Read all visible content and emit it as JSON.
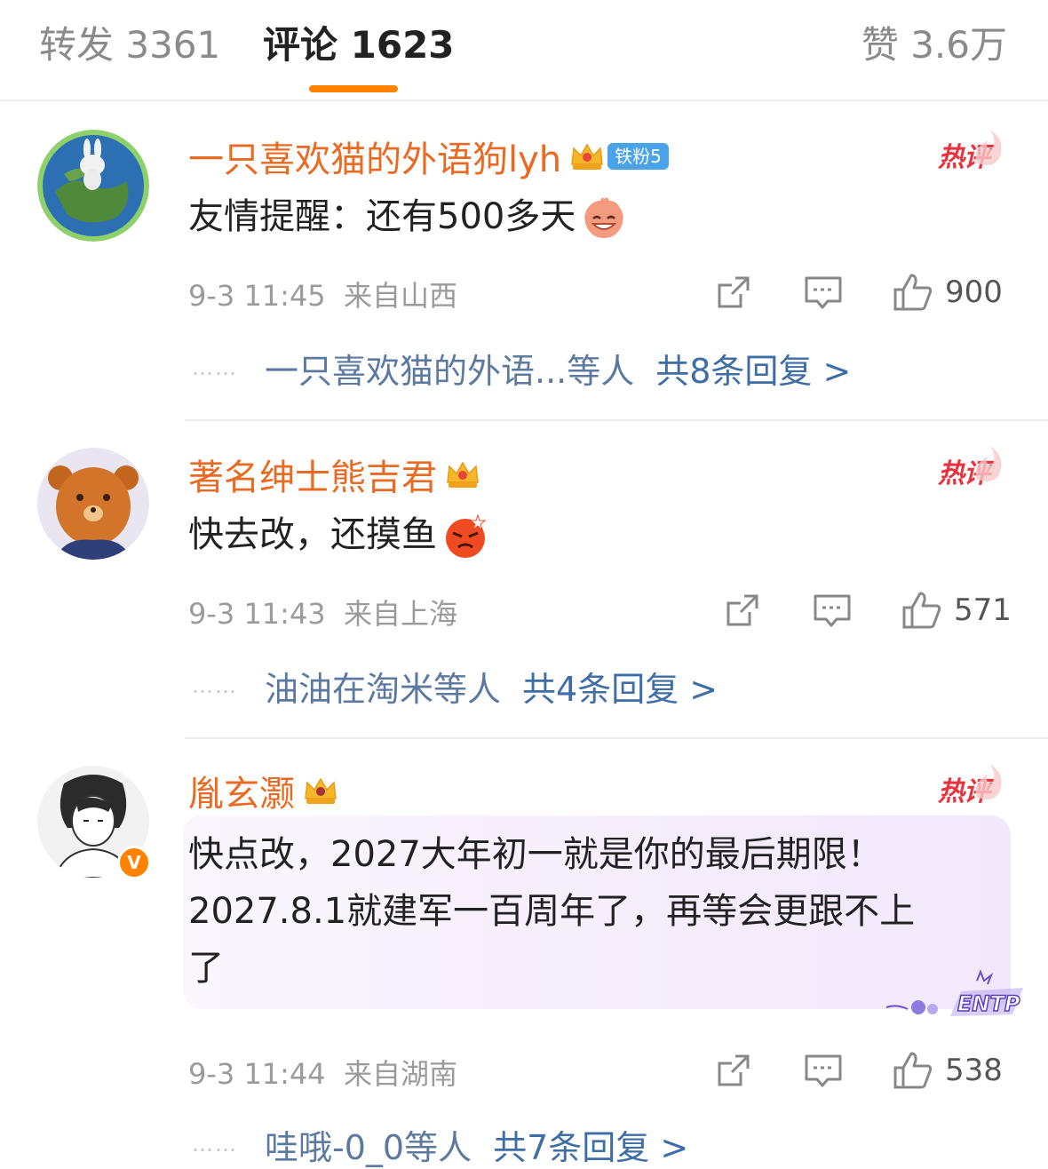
{
  "tabs": {
    "repost": "转发 3361",
    "comments": "评论 1623",
    "likes": "赞 3.6万"
  },
  "colors": {
    "accent": "#ff8200",
    "username": "#e86a23",
    "hot": "#e8333e",
    "link": "#3f6ea6"
  },
  "hot_label": "热评",
  "dots": "……",
  "comments": [
    {
      "username": "一只喜欢猫的外语狗lyh",
      "fan_badge": "铁粉5",
      "text": "友情提醒：还有500多天",
      "emoji": "laughing-emoji",
      "time": "9-3 11:45",
      "location": "来自山西",
      "likes": "900",
      "reply_names": "一只喜欢猫的外语...等人",
      "reply_total": "共8条回复 >"
    },
    {
      "username": "著名绅士熊吉君",
      "text": "快去改，还摸鱼",
      "emoji": "angry-emoji",
      "time": "9-3 11:43",
      "location": "来自上海",
      "likes": "571",
      "reply_names": "油油在淘米等人",
      "reply_total": "共4条回复 >"
    },
    {
      "username": "胤玄灏",
      "text_lines": [
        "快点改，2027大年初一就是你的最后期限！",
        "2027.8.1就建军一百周年了，再等会更跟不上",
        "了"
      ],
      "decor_text": "ENTP",
      "time": "9-3 11:44",
      "location": "来自湖南",
      "likes": "538",
      "reply_names": "哇哦-0_0等人",
      "reply_total": "共7条回复 >"
    }
  ]
}
